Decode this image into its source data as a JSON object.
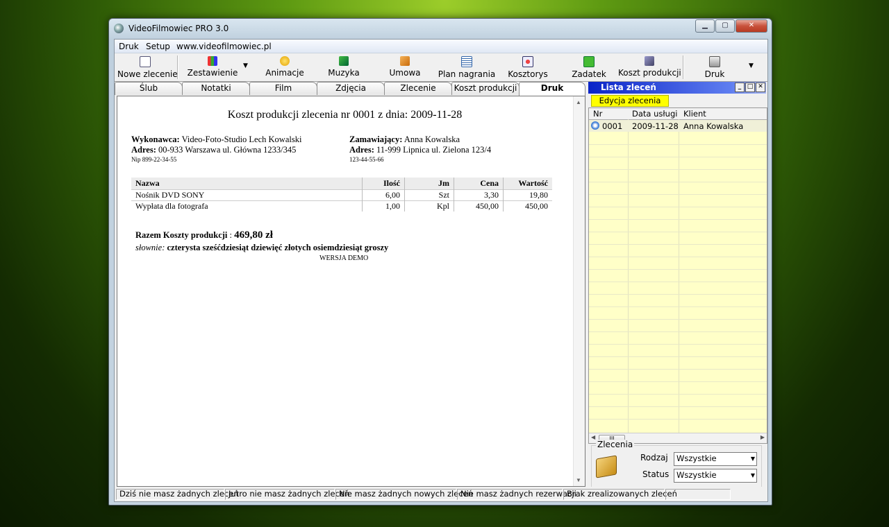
{
  "window": {
    "title": "VideoFilmowiec  PRO 3.0",
    "min": "▁",
    "max": "▢",
    "close": "✕"
  },
  "menu": {
    "items": [
      "Druk",
      "Setup",
      "www.videofilmowiec.pl"
    ]
  },
  "toolbar": {
    "buttons": [
      "Nowe zlecenie",
      "Zestawienie",
      "Animacje",
      "Muzyka",
      "Umowa",
      "Plan nagrania",
      "Kosztorys",
      "Zadatek",
      "Koszt produkcji",
      "Druk"
    ]
  },
  "tabs": [
    "Ślub",
    "Notatki",
    "Film",
    "Zdjęcia",
    "Zlecenie",
    "Koszt produkcji",
    "Druk"
  ],
  "document": {
    "title": "Koszt produkcji zlecenia nr 0001 z dnia: 2009-11-28",
    "contractor_label": "Wykonawca:",
    "contractor_name": "Video-Foto-Studio Lech Kowalski",
    "contractor_addr_label": "Adres:",
    "contractor_addr": "00-933 Warszawa ul. Główna 1233/345",
    "contractor_nip": "Nip 899-22-34-55",
    "client_label": "Zamawiający:",
    "client_name": "Anna Kowalska",
    "client_addr_label": "Adres:",
    "client_addr": "11-999 Lipnica ul. Zielona 123/4",
    "client_phone": "123-44-55-66",
    "table": {
      "headers": [
        "Nazwa",
        "Ilość",
        "Jm",
        "Cena",
        "Wartość"
      ],
      "rows": [
        [
          "Nośnik DVD SONY",
          "6,00",
          "Szt",
          "3,30",
          "19,80"
        ],
        [
          "Wypłata dla fotografa",
          "1,00",
          "Kpl",
          "450,00",
          "450,00"
        ]
      ]
    },
    "total_label": "Razem Koszty produkcji",
    "total_sep": ":",
    "total_value": "469,80 zł",
    "words_label": "słownie:",
    "words_value": "czterysta sześćdziesiąt dziewięć złotych osiemdziesiąt groszy",
    "demo": "WERSJA DEMO"
  },
  "orders_panel": {
    "title": "Lista zleceń",
    "edit_button": "Edycja zlecenia",
    "columns": [
      "Nr",
      "Data usługi",
      "Klient"
    ],
    "rows": [
      [
        "0001",
        "2009-11-28",
        "Anna Kowalska"
      ]
    ],
    "scroll_thumb": "III",
    "group_label": "Zlecenia",
    "rodzaj_label": "Rodzaj",
    "rodzaj_value": "Wszystkie",
    "status_label": "Status",
    "status_value": "Wszystkie"
  },
  "statusbar": [
    "Dziś nie masz żadnych zleceń",
    "Jutro nie masz żadnych zleceń",
    "Nie masz żadnych nowych zleceń",
    "Nie masz żadnych rezerwacji",
    "Brak zrealizowanych zleceń"
  ]
}
